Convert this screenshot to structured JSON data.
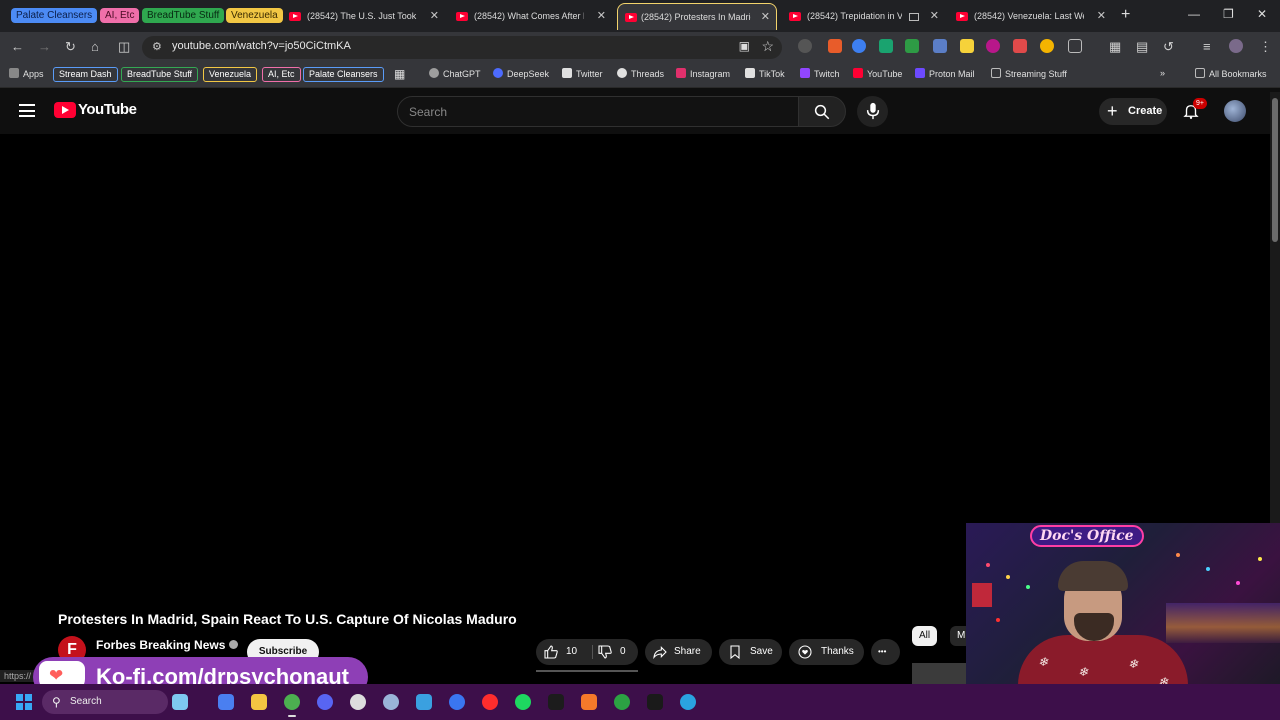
{
  "browser": {
    "tab_groups": [
      {
        "label": "Palate Cleansers",
        "color": "#4c8bf5",
        "text_color": "#0b1f4a"
      },
      {
        "label": "AI, Etc",
        "color": "#f06faa",
        "text_color": "#4a0b24"
      },
      {
        "label": "BreadTube Stuff",
        "color": "#2fa84f",
        "text_color": "#072a12"
      },
      {
        "label": "Venezuela",
        "color": "#f2c744",
        "text_color": "#3a2a00"
      }
    ],
    "tabs": [
      {
        "label": "(28542) The U.S. Just Took M",
        "active": false
      },
      {
        "label": "(28542) What Comes After M",
        "active": false
      },
      {
        "label": "(28542) Protesters In Madrid",
        "active": true
      },
      {
        "label": "(28542) Trepidation in Ve",
        "active": false
      },
      {
        "label": "(28542) Venezuela: Last Wee",
        "active": false
      }
    ],
    "tab_close": "✕",
    "new_tab": "+",
    "url": "youtube.com/watch?v=jo50CiCtmKA",
    "bookmarks": {
      "apps": "Apps",
      "groups": [
        {
          "label": "Stream Dash",
          "color": "#5a9cf8"
        },
        {
          "label": "BreadTube Stuff",
          "color": "#34a853"
        },
        {
          "label": "Venezuela",
          "color": "#f2c744"
        },
        {
          "label": "AI, Etc",
          "color": "#f06faa"
        },
        {
          "label": "Palate Cleansers",
          "color": "#5a9cf8"
        }
      ],
      "links": [
        {
          "label": "ChatGPT",
          "icon_color": "#9e9e9e"
        },
        {
          "label": "DeepSeek",
          "icon_color": "#4d6bfe"
        },
        {
          "label": "Twitter",
          "icon_color": "#e0e0e0"
        },
        {
          "label": "Threads",
          "icon_color": "#e0e0e0"
        },
        {
          "label": "Instagram",
          "icon_color": "#e1306c"
        },
        {
          "label": "TikTok",
          "icon_color": "#e0e0e0"
        },
        {
          "label": "Twitch",
          "icon_color": "#9146ff"
        },
        {
          "label": "YouTube",
          "icon_color": "#ff0033"
        },
        {
          "label": "Proton Mail",
          "icon_color": "#6d4aff"
        },
        {
          "label": "Streaming Stuff",
          "icon_color": "#bbbbbb"
        }
      ],
      "all_bookmarks": "All Bookmarks"
    }
  },
  "youtube": {
    "logo_text": "YouTube",
    "search_placeholder": "Search",
    "create_label": "Create",
    "notification_badge": "9+",
    "video": {
      "title": "Protesters In Madrid, Spain React To U.S. Capture Of Nicolas Maduro",
      "channel": "Forbes Breaking News",
      "channel_initial": "F",
      "subscribe": "Subscribe",
      "likes": "10",
      "dislikes": "0",
      "share": "Share",
      "save": "Save",
      "thanks": "Thanks",
      "more": "•••"
    },
    "chips": [
      {
        "label": "All",
        "selected": true
      },
      {
        "label": "M",
        "selected": false
      }
    ]
  },
  "overlay": {
    "kofi_text": "Ko-fi.com/drpsychonaut",
    "hover_url": "https://"
  },
  "webcam": {
    "sign": "Doc's Office"
  },
  "taskbar": {
    "search": "Search",
    "apps": [
      {
        "name": "widgets",
        "color": "#7ec8f0"
      },
      {
        "name": "messenger",
        "color": "#4a7ff0"
      },
      {
        "name": "file-explorer",
        "color": "#f4c542"
      },
      {
        "name": "chrome",
        "color": "#4caf50"
      },
      {
        "name": "discord",
        "color": "#5865f2"
      },
      {
        "name": "obs",
        "color": "#dddddd"
      },
      {
        "name": "steam",
        "color": "#9ab4d8"
      },
      {
        "name": "edge",
        "color": "#3aa0e0"
      },
      {
        "name": "signal",
        "color": "#3a76f0"
      },
      {
        "name": "youtube-music",
        "color": "#ff2d2d"
      },
      {
        "name": "spotify",
        "color": "#1ed760"
      },
      {
        "name": "terminal",
        "color": "#1c1c1c"
      },
      {
        "name": "blender",
        "color": "#f5792a"
      },
      {
        "name": "xbox",
        "color": "#2ca243"
      },
      {
        "name": "winamp",
        "color": "#1a1a1a"
      },
      {
        "name": "telegram",
        "color": "#2aa3e0"
      }
    ]
  }
}
